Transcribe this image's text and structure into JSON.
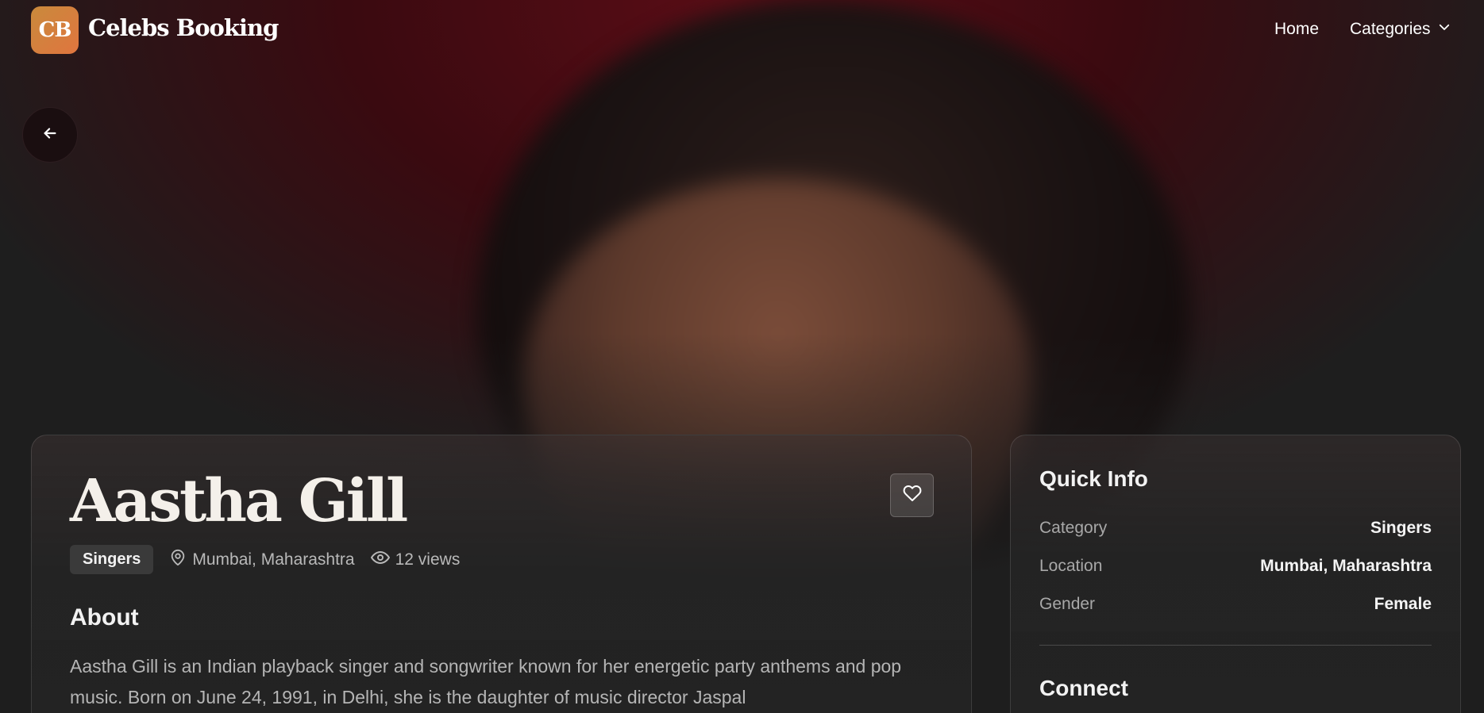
{
  "header": {
    "logo_initials": "CB",
    "brand": "Celebs Booking",
    "nav": {
      "home": "Home",
      "categories": "Categories"
    }
  },
  "icons": {
    "back": "arrow-left-icon",
    "categories_dropdown": "chevron-down-icon",
    "favorite": "heart-icon",
    "location": "map-pin-icon",
    "views": "eye-icon"
  },
  "colors": {
    "logo_gradient_start": "#c98a3c",
    "logo_gradient_end": "#e0753f",
    "hero_tint": "#5a0d16",
    "background": "#1e1e1e"
  },
  "profile": {
    "name": "Aastha Gill",
    "category": "Singers",
    "location": "Mumbai, Maharashtra",
    "views": "12 views",
    "about_heading": "About",
    "about_text": "Aastha Gill is an Indian playback singer and songwriter known for her energetic party anthems and pop music. Born on June 24, 1991, in Delhi, she is the daughter of music director Jaspal"
  },
  "quick_info": {
    "title": "Quick Info",
    "rows": [
      {
        "label": "Category",
        "value": "Singers"
      },
      {
        "label": "Location",
        "value": "Mumbai, Maharashtra"
      },
      {
        "label": "Gender",
        "value": "Female"
      }
    ],
    "connect_title": "Connect"
  }
}
